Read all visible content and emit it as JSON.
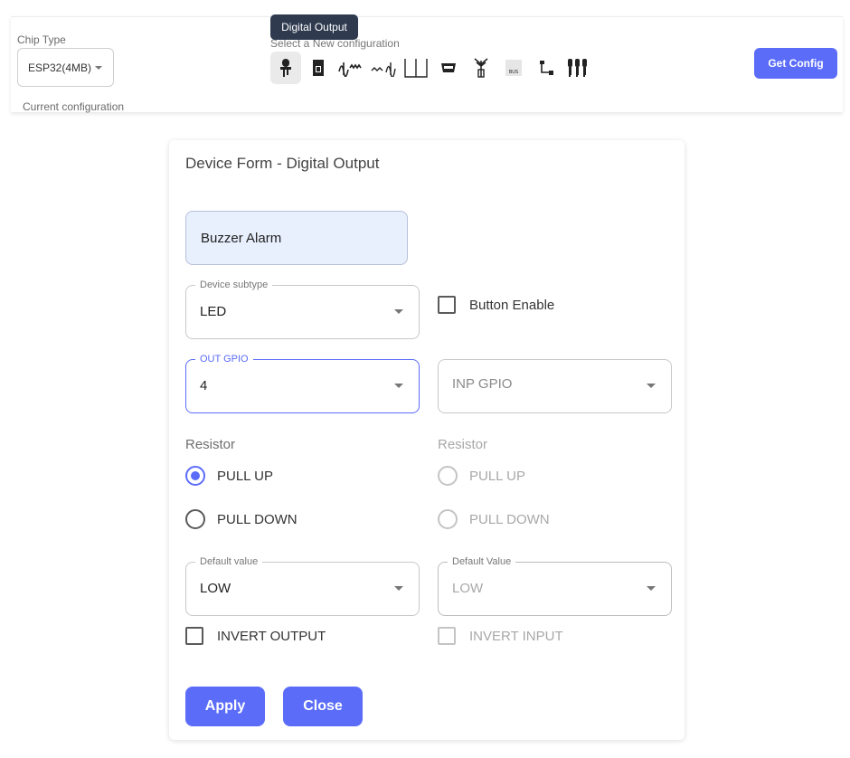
{
  "topbar": {
    "chip_type_label": "Chip Type",
    "chip_type_value": "ESP32(4MB)",
    "current_config_label": "Current configuration",
    "select_new_label": "Select a New configuration",
    "tooltip": "Digital Output",
    "get_config_label": "Get Config",
    "config_icons": [
      "digital-output-icon",
      "memory-card-icon",
      "analog-wave-icon",
      "pwm-wave-icon",
      "pulse-icon",
      "serial-connector-icon",
      "antenna-icon",
      "bus-icon",
      "i2c-icon",
      "multi-pin-icon"
    ]
  },
  "form": {
    "title": "Device Form - Digital Output",
    "device_name": "Buzzer Alarm",
    "device_subtype": {
      "label": "Device subtype",
      "value": "LED"
    },
    "button_enable_label": "Button Enable",
    "out_gpio": {
      "label": "OUT GPIO",
      "value": "4"
    },
    "inp_gpio": {
      "placeholder": "INP GPIO"
    },
    "resistor_left": {
      "label": "Resistor",
      "options": [
        "PULL UP",
        "PULL DOWN"
      ],
      "selected": "PULL UP"
    },
    "resistor_right": {
      "label": "Resistor",
      "options": [
        "PULL UP",
        "PULL DOWN"
      ]
    },
    "default_value_left": {
      "label": "Default value",
      "value": "LOW"
    },
    "default_value_right": {
      "label": "Default Value",
      "value": "LOW"
    },
    "invert_output_label": "INVERT OUTPUT",
    "invert_input_label": "INVERT INPUT",
    "apply_label": "Apply",
    "close_label": "Close"
  },
  "colors": {
    "accent": "#5b6cf9",
    "tooltip_bg": "#2f3a4f",
    "name_input_bg": "#e8effd"
  }
}
